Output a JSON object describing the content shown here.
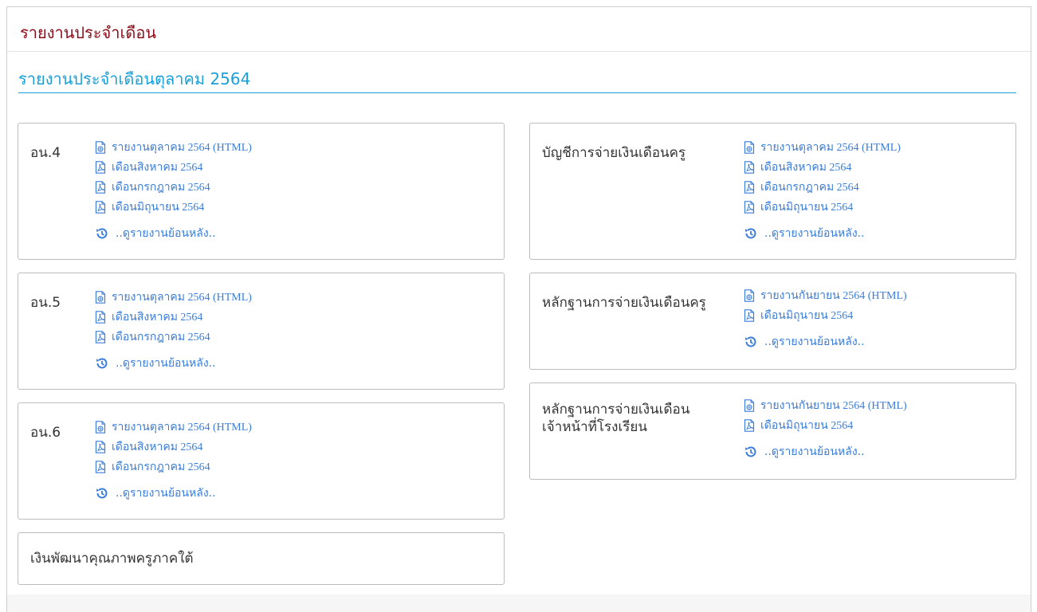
{
  "header": {
    "title": "รายงานประจำเดือน"
  },
  "section": {
    "title": "รายงานประจำเดือนตุลาคม 2564"
  },
  "history_label": "..ดูรายงานย้อนหลัง..",
  "left_boxes": [
    {
      "label": "อน.4",
      "links": [
        {
          "icon": "html-file-icon",
          "text": "รายงานตุลาคม 2564 (HTML)"
        },
        {
          "icon": "pdf-file-icon",
          "text": "เดือนสิงหาคม 2564"
        },
        {
          "icon": "pdf-file-icon",
          "text": "เดือนกรกฎาคม 2564"
        },
        {
          "icon": "pdf-file-icon",
          "text": "เดือนมิถุนายน 2564"
        }
      ]
    },
    {
      "label": "อน.5",
      "links": [
        {
          "icon": "html-file-icon",
          "text": "รายงานตุลาคม 2564 (HTML)"
        },
        {
          "icon": "pdf-file-icon",
          "text": "เดือนสิงหาคม 2564"
        },
        {
          "icon": "pdf-file-icon",
          "text": "เดือนกรกฎาคม 2564"
        }
      ]
    },
    {
      "label": "อน.6",
      "links": [
        {
          "icon": "html-file-icon",
          "text": "รายงานตุลาคม 2564 (HTML)"
        },
        {
          "icon": "pdf-file-icon",
          "text": "เดือนสิงหาคม 2564"
        },
        {
          "icon": "pdf-file-icon",
          "text": "เดือนกรกฎาคม 2564"
        }
      ]
    },
    {
      "label": "เงินพัฒนาคุณภาพครูภาคใต้",
      "links": []
    }
  ],
  "right_boxes": [
    {
      "label": "บัญชีการจ่ายเงินเดือนครู",
      "links": [
        {
          "icon": "html-file-icon",
          "text": "รายงานตุลาคม 2564 (HTML)"
        },
        {
          "icon": "pdf-file-icon",
          "text": "เดือนสิงหาคม 2564"
        },
        {
          "icon": "pdf-file-icon",
          "text": "เดือนกรกฎาคม 2564"
        },
        {
          "icon": "pdf-file-icon",
          "text": "เดือนมิถุนายน 2564"
        }
      ]
    },
    {
      "label": "หลักฐานการจ่ายเงินเดือนครู",
      "links": [
        {
          "icon": "html-file-icon",
          "text": "รายงานกันยายน 2564 (HTML)"
        },
        {
          "icon": "pdf-file-icon",
          "text": "เดือนมิถุนายน 2564"
        }
      ]
    },
    {
      "label_lines": [
        "หลักฐานการจ่ายเงินเดือน",
        "เจ้าหน้าที่โรงเรียน"
      ],
      "links": [
        {
          "icon": "html-file-icon",
          "text": "รายงานกันยายน 2564 (HTML)"
        },
        {
          "icon": "pdf-file-icon",
          "text": "เดือนมิถุนายน 2564"
        }
      ]
    }
  ],
  "colors": {
    "header_title": "#8b0e1a",
    "accent": "#1a9fd8",
    "link": "#3b7dd8"
  }
}
